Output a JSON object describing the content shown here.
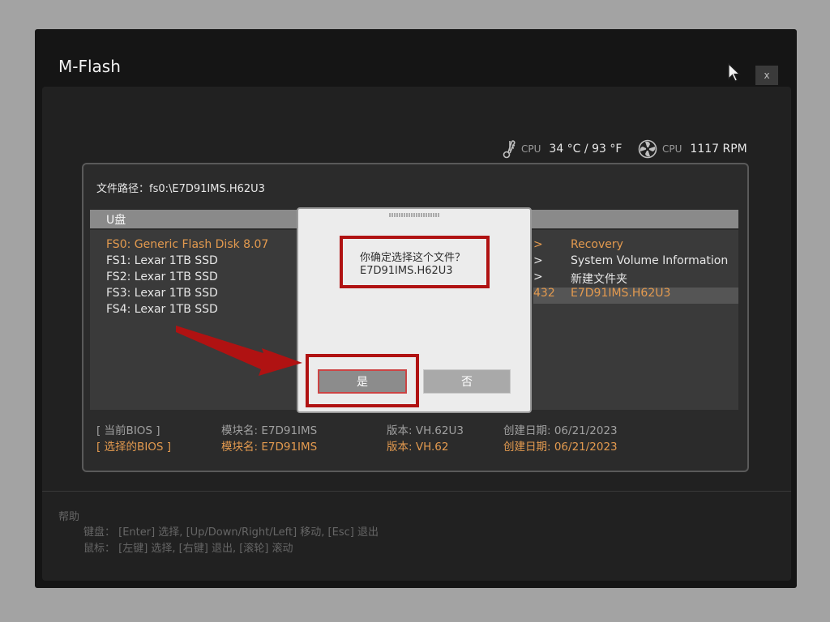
{
  "window": {
    "title": "M-Flash",
    "close_label": "x"
  },
  "hardware": {
    "cpu_temp": {
      "label": "CPU",
      "value": "34 °C / 93 °F"
    },
    "cpu_fan": {
      "label": "CPU",
      "value": "1117 RPM"
    }
  },
  "file_path": {
    "label": "文件路径：fs0:\\E7D91IMS.H62U3"
  },
  "list_header": "U盘",
  "drives": [
    "FS0: Generic Flash Disk 8.07",
    "FS1: Lexar 1TB SSD",
    "FS2: Lexar 1TB SSD",
    "FS3: Lexar 1TB SSD",
    "FS4: Lexar 1TB SSD"
  ],
  "files": [
    {
      "marker": ">",
      "name": "Recovery"
    },
    {
      "marker": ">",
      "name": "System Volume Information"
    },
    {
      "marker": ">",
      "name": "新建文件夹"
    },
    {
      "marker": "432",
      "name": "E7D91IMS.H62U3"
    }
  ],
  "bios_info": {
    "current": {
      "label": "[    当前BIOS     ]",
      "module": "模块名: E7D91IMS",
      "version": "版本: VH.62U3",
      "date": "创建日期: 06/21/2023"
    },
    "selected": {
      "label": "[   选择的BIOS   ]",
      "module": "模块名: E7D91IMS",
      "version": "版本: VH.62",
      "date": "创建日期: 06/21/2023"
    }
  },
  "help": {
    "title": "帮助",
    "keyboard": "键盘：  [Enter] 选择,  [Up/Down/Right/Left] 移动,  [Esc] 退出",
    "mouse": "鼠标：  [左键] 选择,  [右键] 退出,  [滚轮] 滚动"
  },
  "dialog": {
    "question": "你确定选择这个文件？",
    "filename": "E7D91IMS.H62U3",
    "yes": "是",
    "no": "否"
  },
  "colors": {
    "highlight": "#e39a4f",
    "annotation": "#b01212",
    "background": "#151515"
  }
}
